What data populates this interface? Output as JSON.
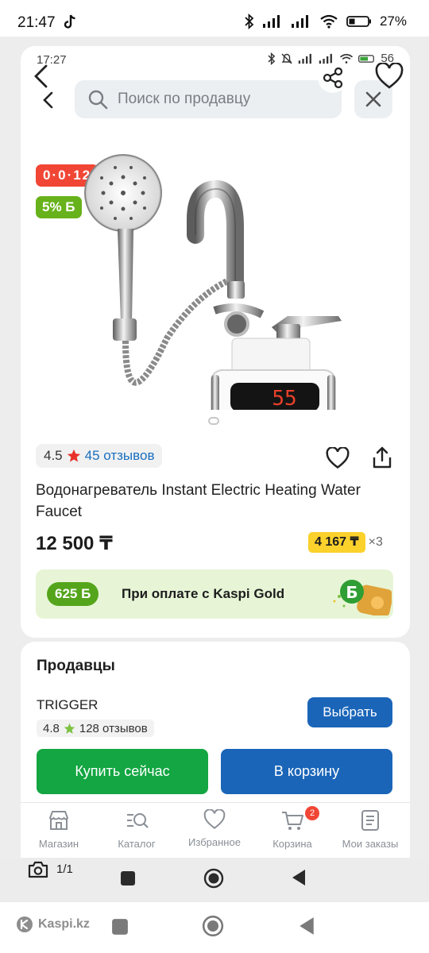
{
  "status_bar": {
    "time": "21:47",
    "battery": "27%"
  },
  "inner_status_bar": {
    "time": "17:27",
    "battery": "56"
  },
  "search": {
    "placeholder": "Поиск по продавцу"
  },
  "badges": {
    "timer": "0·0·12",
    "bonus": "5% Б"
  },
  "product": {
    "rating": "4.5",
    "reviews": "45 отзывов",
    "title": "Водонагреватель Instant Electric Heating Water Faucet",
    "price": "12 500 ₸",
    "installment_price": "4 167 ₸",
    "installment_multiplier": "×3",
    "display_digits": "55"
  },
  "gold_banner": {
    "bonus": "625 Б",
    "text": "При оплате с Kaspi Gold"
  },
  "sellers": {
    "heading": "Продавцы",
    "items": [
      {
        "name": "TRIGGER",
        "rating": "4.8",
        "reviews": "128 отзывов",
        "action": "Выбрать"
      }
    ]
  },
  "actions": {
    "buy_now": "Купить сейчас",
    "add_to_cart": "В корзину"
  },
  "tabbar": {
    "items": [
      {
        "label": "Магазин",
        "icon": "shop-icon"
      },
      {
        "label": "Каталог",
        "icon": "catalog-search-icon"
      },
      {
        "label": "Избранное",
        "icon": "heart-icon"
      },
      {
        "label": "Корзина",
        "icon": "cart-icon"
      },
      {
        "label": "Мои заказы",
        "icon": "orders-icon"
      }
    ],
    "cart_badge": "2"
  },
  "gallery_counter": "1/1",
  "watermark": "Kaspi.kz",
  "colors": {
    "kaspi_red": "#f14635",
    "bonus_green": "#67b21b",
    "primary_blue": "#1a65b8",
    "buy_green": "#13a642",
    "installment_yellow": "#fbd12c"
  }
}
